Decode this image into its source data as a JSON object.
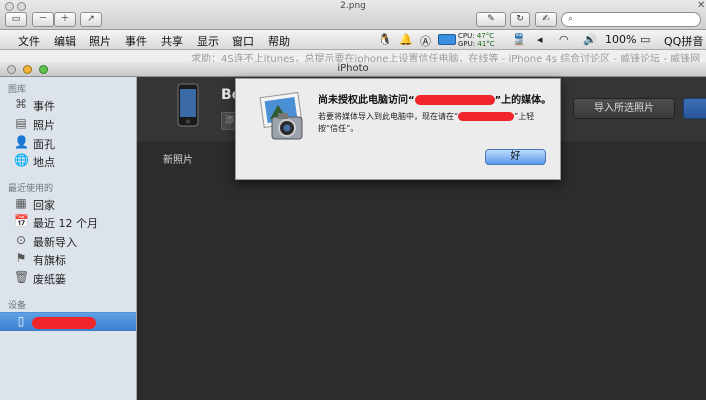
{
  "preview": {
    "title": "2.png",
    "search_placeholder": "",
    "close": "✕"
  },
  "menubar": {
    "items": [
      "文件",
      "编辑",
      "照片",
      "事件",
      "共享",
      "显示",
      "窗口",
      "帮助"
    ],
    "battery": "100%",
    "cpu_label": "CPU:",
    "cpu_temp": "47°C",
    "gpu_label": "GPU:",
    "gpu_temp": "41°C",
    "qq_label": "QQ拼音"
  },
  "browser_tab": {
    "text": "求助：4S连不上itunes，总提示要在iphone上设置信任电脑，在线等 - iPhone 4s 综合讨论区 - 威锋论坛 - 威锋网"
  },
  "window": {
    "title": "iPhoto"
  },
  "sidebar": {
    "library_header": "图库",
    "library_items": [
      {
        "label": "事件",
        "icon": "events-icon"
      },
      {
        "label": "照片",
        "icon": "photos-icon"
      },
      {
        "label": "面孔",
        "icon": "faces-icon"
      },
      {
        "label": "地点",
        "icon": "places-icon"
      }
    ],
    "recent_header": "最近使用的",
    "recent_items": [
      {
        "label": "回家",
        "icon": "event-icon"
      },
      {
        "label": "最近 12 个月",
        "icon": "calendar-icon"
      },
      {
        "label": "最新导入",
        "icon": "import-icon"
      },
      {
        "label": "有旗标",
        "icon": "flag-icon"
      },
      {
        "label": "废纸篓",
        "icon": "trash-icon"
      }
    ],
    "devices_header": "设备"
  },
  "main": {
    "device_name": "Bebe",
    "import_placeholder": "添",
    "import_selected_label": "导入所选照片",
    "new_photos_label": "新照片"
  },
  "dialog": {
    "title_prefix": "尚未授权此电脑访问“",
    "title_suffix": "”上的媒体。",
    "message_prefix": "若要将媒体导入到此电脑中，现在请在“",
    "message_suffix": "”上轻按“信任”。",
    "ok_label": "好"
  },
  "colors": {
    "redaction": "#f0262c",
    "selection": "#3b7fd0"
  }
}
